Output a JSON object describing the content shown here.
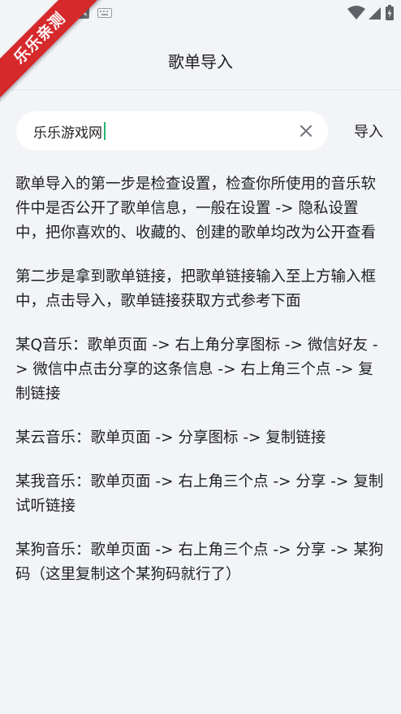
{
  "ribbon": {
    "text": "乐乐亲测"
  },
  "header": {
    "title": "歌单导入"
  },
  "search": {
    "value": "乐乐游戏网",
    "import_label": "导入"
  },
  "instructions": [
    "歌单导入的第一步是检查设置，检查你所使用的音乐软件中是否公开了歌单信息，一般在设置 -> 隐私设置中，把你喜欢的、收藏的、创建的歌单均改为公开查看",
    "第二步是拿到歌单链接，把歌单链接输入至上方输入框中，点击导入，歌单链接获取方式参考下面",
    "某Q音乐：歌单页面 -> 右上角分享图标 -> 微信好友 -> 微信中点击分享的这条信息 -> 右上角三个点 -> 复制链接",
    "某云音乐：歌单页面 -> 分享图标 -> 复制链接",
    "某我音乐：歌单页面 -> 右上角三个点 -> 分享 -> 复制试听链接",
    "某狗音乐：歌单页面 -> 右上角三个点 -> 分享 -> 某狗码（这里复制这个某狗码就行了）"
  ],
  "colors": {
    "background": "#f3f4f8",
    "ribbon": "#d6292b",
    "caret": "#22b573"
  }
}
